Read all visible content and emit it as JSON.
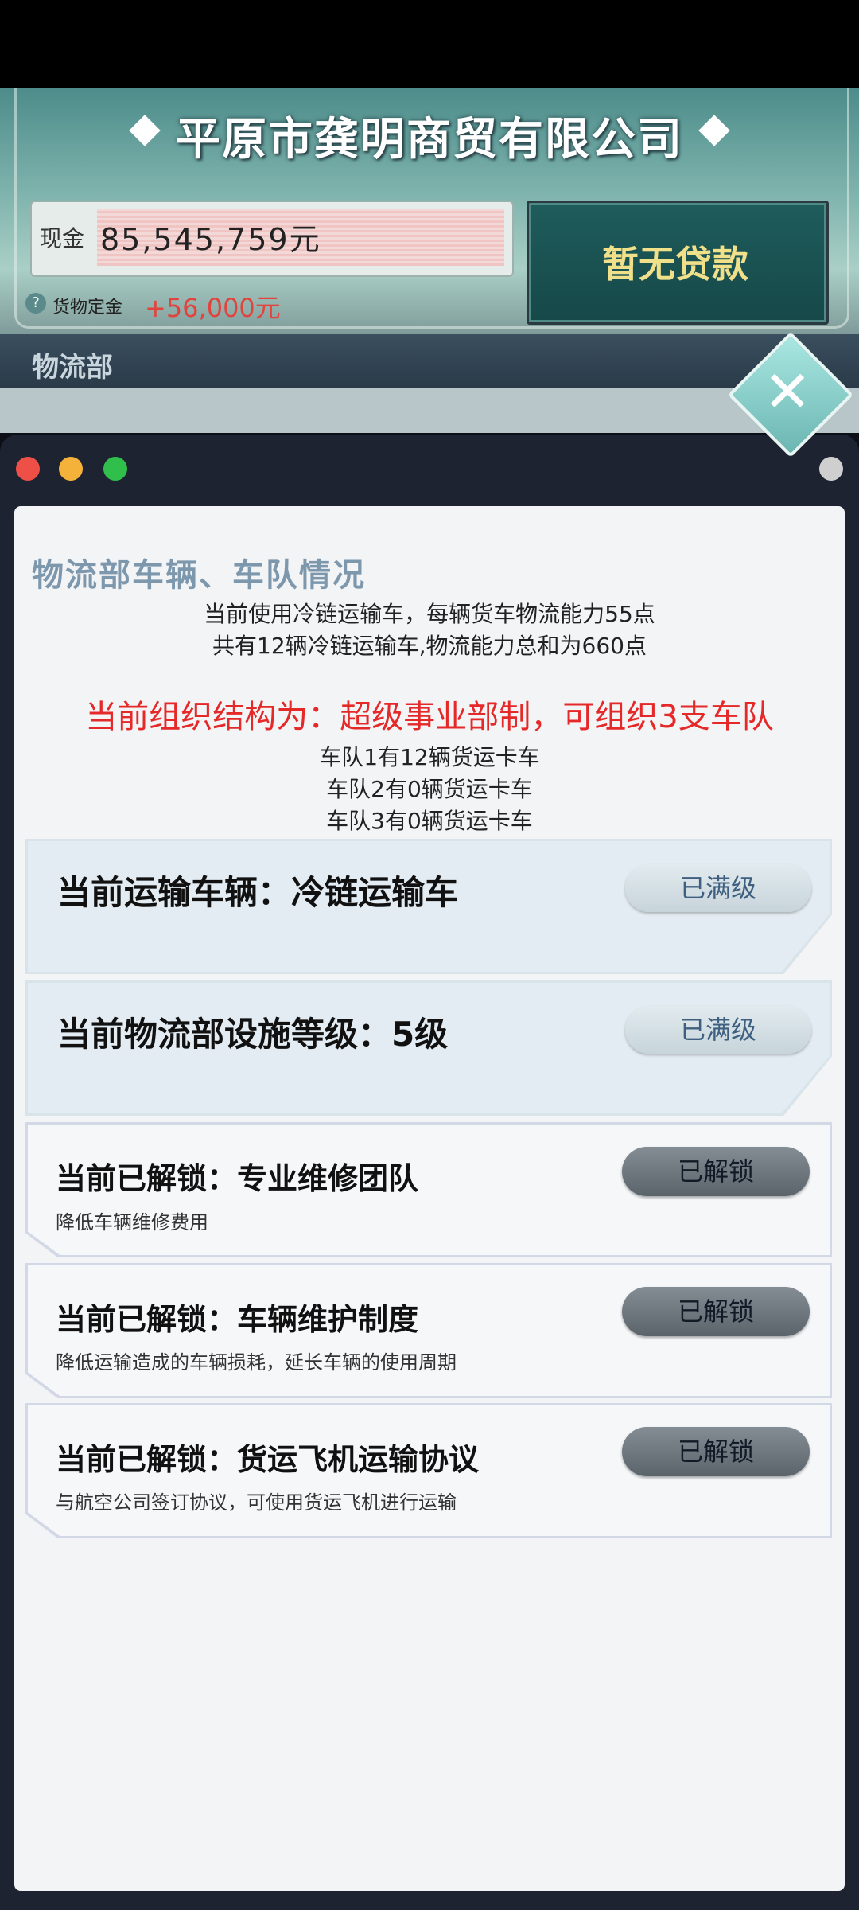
{
  "header": {
    "company_name": "平原市龚明商贸有限公司",
    "cash_label": "现金",
    "cash_value": "85,545,759元",
    "deposit_help_icon": "?",
    "deposit_label": "货物定金",
    "deposit_value": "+56,000元",
    "loan_button_label": "暂无贷款",
    "department_label": "物流部"
  },
  "close_button": {
    "icon": "close-x-icon",
    "glyph": "✕"
  },
  "window_controls": {
    "colors": {
      "close": "#ee4f47",
      "minimize": "#f5b23a",
      "maximize": "#2fbf4a",
      "right": "#cfcfcf"
    }
  },
  "panel": {
    "title": "物流部车辆、车队情况",
    "info_lines": [
      "当前使用冷链运输车，每辆货车物流能力55点",
      "共有12辆冷链运输车,物流能力总和为660点"
    ],
    "org_structure": "当前组织结构为：超级事业部制，可组织3支车队",
    "fleet_lines": [
      "车队1有12辆货运卡车",
      "车队2有0辆货运卡车",
      "车队3有0辆货运卡车"
    ],
    "cards": [
      {
        "title": "当前运输车辆：冷链运输车",
        "button": "已满级"
      },
      {
        "title": "当前物流部设施等级：5级",
        "button": "已满级"
      },
      {
        "title": "当前已解锁：专业维修团队",
        "desc": "降低车辆维修费用",
        "button": "已解锁"
      },
      {
        "title": "当前已解锁：车辆维护制度",
        "desc": "降低运输造成的车辆损耗，延长车辆的使用周期",
        "button": "已解锁"
      },
      {
        "title": "当前已解锁：货运飞机运输协议",
        "desc": "与航空公司签订协议，可使用货运飞机进行运输",
        "button": "已解锁"
      }
    ]
  }
}
